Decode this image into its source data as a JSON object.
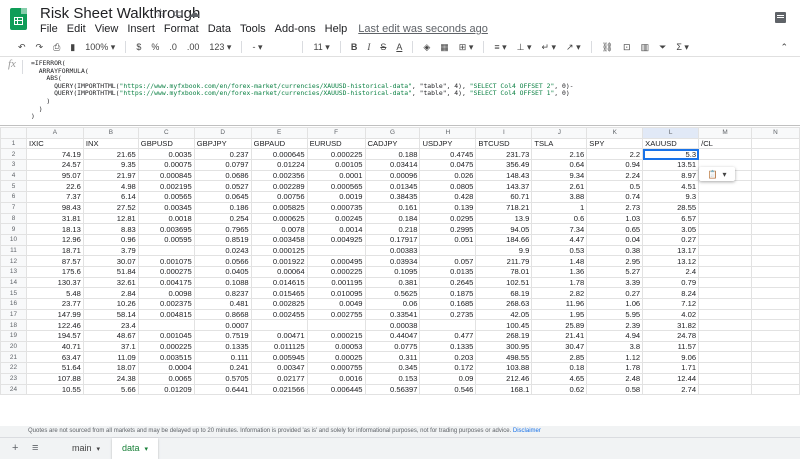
{
  "doc": {
    "title": "Risk Sheet Walkthrough",
    "menus": [
      "File",
      "Edit",
      "View",
      "Insert",
      "Format",
      "Data",
      "Tools",
      "Add-ons",
      "Help"
    ],
    "last_edit": "Last edit was seconds ago"
  },
  "toolbar": {
    "zoom": "100%",
    "currency": "$",
    "percent": "%",
    "dec_less": ".0",
    "dec_more": ".00",
    "format": "123",
    "font": "-",
    "size": "11",
    "bold": "B",
    "italic": "I",
    "strike": "S",
    "color": "A"
  },
  "formula": {
    "fx": "fx",
    "line1": "=IFERROR(",
    "line2": "  ARRAYFORMULA(",
    "line3": "    ABS(",
    "line4a": "      QUERY(IMPORTHTML(",
    "url": "\"https://www.myfxbook.com/en/forex-market/currencies/XAUUSD-historical-data\"",
    "tbl4": ", \"table\", 4), ",
    "q1": "\"SELECT Col4 OFFSET 2\"",
    "line4z": ", 0)-",
    "q2": "\"SELECT Col4 OFFSET 1\"",
    "line5z": ", 0)",
    "line6": "    )",
    "line7": "  )",
    "line8": ")"
  },
  "grid": {
    "columns": [
      "A",
      "B",
      "C",
      "D",
      "E",
      "F",
      "G",
      "H",
      "I",
      "J",
      "K",
      "L",
      "M",
      "N"
    ],
    "header_row": [
      "IXIC",
      "INX",
      "GBPUSD",
      "GBPJPY",
      "GBPAUD",
      "EURUSD",
      "CADJPY",
      "USDJPY",
      "BTCUSD",
      "TSLA",
      "SPY",
      "XAUUSD",
      "/CL",
      ""
    ],
    "rows": [
      [
        "74.19",
        "21.65",
        "0.0035",
        "0.237",
        "0.000645",
        "0.000225",
        "0.188",
        "0.4745",
        "231.73",
        "2.16",
        "2.2",
        "5.3",
        "",
        ""
      ],
      [
        "24.57",
        "9.35",
        "0.00075",
        "0.0797",
        "0.01224",
        "0.00105",
        "0.03414",
        "0.0475",
        "356.49",
        "0.64",
        "0.94",
        "13.51",
        "",
        ""
      ],
      [
        "95.07",
        "21.97",
        "0.000845",
        "0.0686",
        "0.002356",
        "0.0001",
        "0.00096",
        "0.026",
        "148.43",
        "9.34",
        "2.24",
        "8.97",
        "",
        ""
      ],
      [
        "22.6",
        "4.98",
        "0.002195",
        "0.0527",
        "0.002289",
        "0.000565",
        "0.01345",
        "0.0805",
        "143.37",
        "2.61",
        "0.5",
        "4.51",
        "",
        ""
      ],
      [
        "7.37",
        "6.14",
        "0.00565",
        "0.0645",
        "0.00756",
        "0.0019",
        "0.38435",
        "0.428",
        "60.71",
        "3.88",
        "0.74",
        "9.3",
        "",
        ""
      ],
      [
        "98.43",
        "27.52",
        "0.00345",
        "0.186",
        "0.005825",
        "0.000735",
        "0.161",
        "0.139",
        "718.21",
        "1",
        "2.73",
        "28.55",
        "",
        ""
      ],
      [
        "31.81",
        "12.81",
        "0.0018",
        "0.254",
        "0.000625",
        "0.00245",
        "0.184",
        "0.0295",
        "13.9",
        "0.6",
        "1.03",
        "6.57",
        "",
        ""
      ],
      [
        "18.13",
        "8.83",
        "0.003695",
        "0.7965",
        "0.0078",
        "0.0014",
        "0.218",
        "0.2995",
        "94.05",
        "7.34",
        "0.65",
        "3.05",
        "",
        ""
      ],
      [
        "12.96",
        "0.96",
        "0.00595",
        "0.8519",
        "0.003458",
        "0.004925",
        "0.17917",
        "0.051",
        "184.66",
        "4.47",
        "0.04",
        "0.27",
        "",
        ""
      ],
      [
        "18.71",
        "3.79",
        "",
        "0.0243",
        "0.000125",
        "",
        "0.00383",
        "",
        "9.9",
        "0.53",
        "0.38",
        "13.17",
        "",
        ""
      ],
      [
        "87.57",
        "30.07",
        "0.001075",
        "0.0566",
        "0.001922",
        "0.000495",
        "0.03934",
        "0.057",
        "211.79",
        "1.48",
        "2.95",
        "13.12",
        "",
        ""
      ],
      [
        "175.6",
        "51.84",
        "0.000275",
        "0.0405",
        "0.00064",
        "0.000225",
        "0.1095",
        "0.0135",
        "78.01",
        "1.36",
        "5.27",
        "2.4",
        "",
        ""
      ],
      [
        "130.37",
        "32.61",
        "0.004175",
        "0.1088",
        "0.014615",
        "0.001195",
        "0.381",
        "0.2645",
        "102.51",
        "1.78",
        "3.39",
        "0.79",
        "",
        ""
      ],
      [
        "5.48",
        "2.84",
        "0.0098",
        "0.8237",
        "0.015465",
        "0.010095",
        "0.5625",
        "0.1875",
        "68.19",
        "2.82",
        "0.27",
        "8.24",
        "",
        ""
      ],
      [
        "23.77",
        "10.26",
        "0.002375",
        "0.481",
        "0.002825",
        "0.0049",
        "0.06",
        "0.1685",
        "268.63",
        "11.96",
        "1.06",
        "7.12",
        "",
        ""
      ],
      [
        "147.99",
        "58.14",
        "0.004815",
        "0.8668",
        "0.002455",
        "0.002755",
        "0.33541",
        "0.2735",
        "42.05",
        "1.95",
        "5.95",
        "4.02",
        "",
        ""
      ],
      [
        "122.46",
        "23.4",
        "",
        "0.0007",
        "",
        "",
        "0.00038",
        "",
        "100.45",
        "25.89",
        "2.39",
        "31.82",
        "",
        ""
      ],
      [
        "194.57",
        "48.67",
        "0.001045",
        "0.7519",
        "0.00471",
        "0.000215",
        "0.44047",
        "0.477",
        "268.19",
        "21.41",
        "4.94",
        "24.78",
        "",
        ""
      ],
      [
        "40.71",
        "37.1",
        "0.000225",
        "0.1335",
        "0.011125",
        "0.00053",
        "0.0775",
        "0.1335",
        "300.95",
        "30.47",
        "3.8",
        "11.57",
        "",
        ""
      ],
      [
        "63.47",
        "11.09",
        "0.003515",
        "0.111",
        "0.005945",
        "0.00025",
        "0.311",
        "0.203",
        "498.55",
        "2.85",
        "1.12",
        "9.06",
        "",
        ""
      ],
      [
        "51.64",
        "18.07",
        "0.0004",
        "0.241",
        "0.00347",
        "0.000755",
        "0.345",
        "0.172",
        "103.88",
        "0.18",
        "1.78",
        "1.71",
        "",
        ""
      ],
      [
        "107.88",
        "24.38",
        "0.0065",
        "0.5705",
        "0.02177",
        "0.0016",
        "0.153",
        "0.09",
        "212.46",
        "4.65",
        "2.48",
        "12.44",
        "",
        ""
      ],
      [
        "10.55",
        "5.66",
        "0.01209",
        "0.6441",
        "0.021566",
        "0.006445",
        "0.56397",
        "0.546",
        "168.1",
        "0.62",
        "0.58",
        "2.74",
        "",
        ""
      ]
    ]
  },
  "note": {
    "text": "Quotes are not sourced from all markets and may be delayed up to 20 minutes. Information is provided 'as is' and solely for informational purposes, not for trading purposes or advice.",
    "link": "Disclaimer"
  },
  "tabs": {
    "add": "+",
    "list": "≡",
    "sheets": [
      "main",
      "data"
    ],
    "active": "data"
  },
  "colors": {
    "accent": "#1a73e8",
    "sheets_green": "#0f9d58",
    "active_tab": "#188038"
  }
}
